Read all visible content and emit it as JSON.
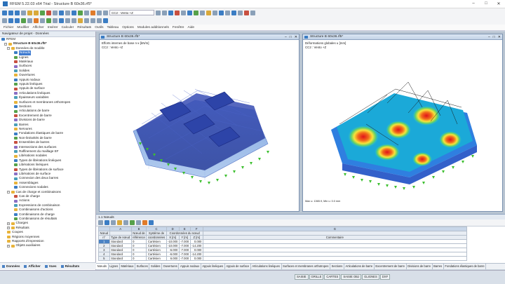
{
  "window": {
    "title": "RFEM 5.22.03 x64 Trial - Structure B 60x36.rf5*",
    "controls": [
      "–",
      "□",
      "✕"
    ]
  },
  "toolbar": {
    "load_case_combo": "CC2 : Vento +Z"
  },
  "menu": [
    "Fichier",
    "Modifier",
    "Afficher",
    "Insérer",
    "Calculer",
    "Résultats",
    "Outils",
    "Tableau",
    "Options",
    "Modules additionnels",
    "Fenêtre",
    "Aide"
  ],
  "navigator": {
    "title": "Navigateur de projet - Données",
    "root": "RFEM",
    "model": "Structure B 60x36.rf5*",
    "items": [
      {
        "label": "Données de modèle",
        "level": 1,
        "exp": "−"
      },
      {
        "label": "Nœuds",
        "level": 2,
        "selected": true
      },
      {
        "label": "Lignes",
        "level": 2
      },
      {
        "label": "Matériaux",
        "level": 2
      },
      {
        "label": "Surfaces",
        "level": 2
      },
      {
        "label": "Solides",
        "level": 2
      },
      {
        "label": "Ouvertures",
        "level": 2
      },
      {
        "label": "Appuis nodaux",
        "level": 2
      },
      {
        "label": "Appuis linéiques",
        "level": 2
      },
      {
        "label": "Appuis de surface",
        "level": 2
      },
      {
        "label": "Articulations linéiques",
        "level": 2
      },
      {
        "label": "Épaisseurs variables",
        "level": 2
      },
      {
        "label": "Surfaces et membranes orthotropes",
        "level": 2
      },
      {
        "label": "Sections",
        "level": 2
      },
      {
        "label": "Articulations de barre",
        "level": 2
      },
      {
        "label": "Excentrement de barre",
        "level": 2
      },
      {
        "label": "Divisions de barre",
        "level": 2
      },
      {
        "label": "Barres",
        "level": 2
      },
      {
        "label": "Nervures",
        "level": 2
      },
      {
        "label": "Fondations élastiques de barre",
        "level": 2
      },
      {
        "label": "Non-linéarités de barre",
        "level": 2
      },
      {
        "label": "Ensembles de barres",
        "level": 2
      },
      {
        "label": "Intersections des surfaces",
        "level": 2
      },
      {
        "label": "Raffinement du maillage EF",
        "level": 2
      },
      {
        "label": "Libérations nodales",
        "level": 2
      },
      {
        "label": "Types de libérations linéiques",
        "level": 2
      },
      {
        "label": "Libérations linéiques",
        "level": 2
      },
      {
        "label": "Types de libérations de surface",
        "level": 2
      },
      {
        "label": "Libérations de surface",
        "level": 2
      },
      {
        "label": "Connexion des deux barres",
        "level": 2
      },
      {
        "label": "Assemblages",
        "level": 2
      },
      {
        "label": "Connexions nodales",
        "level": 2
      },
      {
        "label": "Cas de charge et combinaisons",
        "level": 1,
        "exp": "−"
      },
      {
        "label": "Cas de charge",
        "level": 2
      },
      {
        "label": "Actions",
        "level": 2
      },
      {
        "label": "Expressions de combinaison",
        "level": 2
      },
      {
        "label": "Combinaisons d'actions",
        "level": 2
      },
      {
        "label": "Combinaisons de charge",
        "level": 2
      },
      {
        "label": "Combinaisons de résultats",
        "level": 2
      },
      {
        "label": "Charges",
        "level": 1,
        "exp": "+"
      },
      {
        "label": "Résultats",
        "level": 1,
        "exp": "+"
      },
      {
        "label": "Coupes",
        "level": 1
      },
      {
        "label": "Régions moyennes",
        "level": 1
      },
      {
        "label": "Rapports d'impression",
        "level": 1
      },
      {
        "label": "Objets auxiliaires",
        "level": 1,
        "exp": "+"
      }
    ],
    "tabs": [
      "Données",
      "Afficher",
      "Vues",
      "Résultats"
    ]
  },
  "windows": [
    {
      "title": "Structure B 60x36.rf5*",
      "caption1": "Efforts internes de base n-x [kN/m]",
      "caption2": "CC2 : Vento +Z"
    },
    {
      "title": "Structure B 60x36.rf5*",
      "caption1": "Déformations globales u [mm]",
      "caption2": "CC2 : Vento +Z",
      "footer": "Max u: 1365.9, Min u: 0.0 mm"
    }
  ],
  "table": {
    "title": "1.1 Nœuds",
    "col_letters": [
      "A",
      "B",
      "C",
      "D",
      "E",
      "F",
      "G"
    ],
    "headers_top": [
      "Nœud",
      "Nœud de",
      "Système de",
      "Coordonnées du nœud",
      "",
      "",
      ""
    ],
    "headers_bot": [
      "n°",
      "Type de nœud",
      "référence",
      "coordonnées",
      "X [m]",
      "Y [m]",
      "Z [m]",
      "Commentaire"
    ],
    "rows": [
      [
        "1",
        "Standard",
        "0",
        "Cartésien",
        "-10.000",
        "-7.000",
        "0.000",
        ""
      ],
      [
        "2",
        "Standard",
        "0",
        "Cartésien",
        "-10.000",
        "-7.000",
        "-14.200",
        ""
      ],
      [
        "3",
        "Standard",
        "0",
        "Cartésien",
        "-6.000",
        "-7.000",
        "0.000",
        ""
      ],
      [
        "4",
        "Standard",
        "0",
        "Cartésien",
        "-6.000",
        "-7.000",
        "-14.200",
        ""
      ],
      [
        "5",
        "Standard",
        "0",
        "Cartésien",
        "6.000",
        "-7.000",
        "0.000",
        ""
      ]
    ]
  },
  "table_tabs": [
    "Nœuds",
    "Lignes",
    "Matériaux",
    "Surfaces",
    "Solides",
    "Ouvertures",
    "Appuis nodaux",
    "Appuis linéiques",
    "Appuis de surface",
    "Articulations linéiques",
    "Surfaces et membranes orthotropes",
    "Sections",
    "Articulations de barre",
    "Excentrement de barre",
    "Divisions de barre",
    "Barres",
    "Fondations élastiques de barre"
  ],
  "status": [
    "SAISIE",
    "GRILLE",
    "CARTES",
    "SAISIE OBJ",
    "GLIGNES",
    "DXF"
  ]
}
